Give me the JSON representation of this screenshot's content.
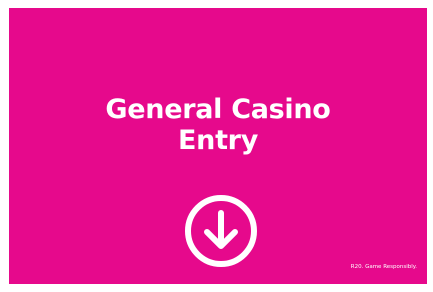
{
  "sign": {
    "background_color": "#e6098c",
    "text_color": "#ffffff",
    "title_line_1": "General Casino",
    "title_line_2": "Entry",
    "icon": "arrow-down-circle-icon",
    "disclaimer": "R20. Game Responsibly."
  }
}
